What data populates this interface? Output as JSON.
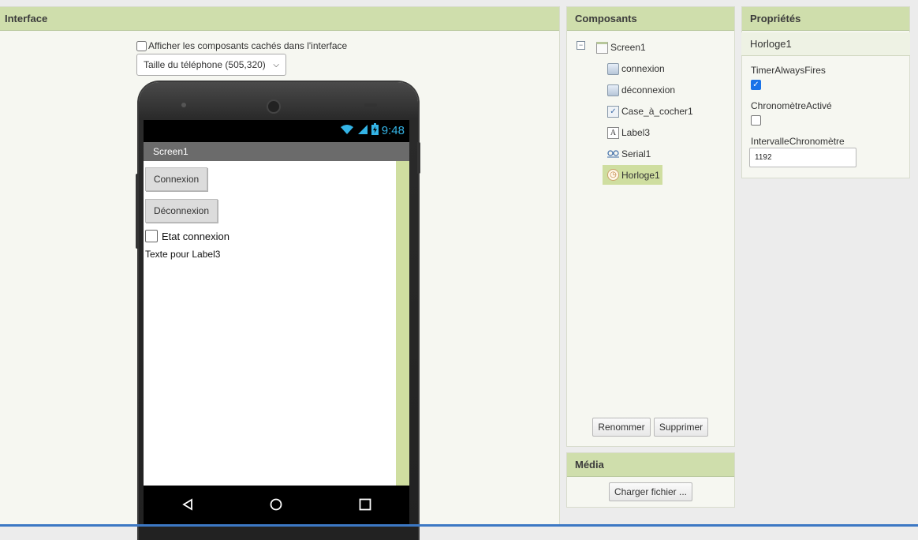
{
  "viewer": {
    "title": "Interface",
    "hidden_components_label": "Afficher les composants cachés dans l'interface",
    "hidden_components_checked": false,
    "phone_size_selected": "Taille du téléphone (505,320)",
    "phone": {
      "time": "9:48",
      "screen_title": "Screen1",
      "buttons": [
        "Connexion",
        "Déconnexion"
      ],
      "checkbox_label": "Etat connexion",
      "label_text": "Texte pour Label3"
    }
  },
  "components": {
    "title": "Composants",
    "tree": [
      {
        "name": "Screen1",
        "icon": "screen-icon"
      },
      {
        "name": "connexion",
        "icon": "button-icon"
      },
      {
        "name": "déconnexion",
        "icon": "button-icon"
      },
      {
        "name": "Case_à_cocher1",
        "icon": "checkbox-icon"
      },
      {
        "name": "Label3",
        "icon": "label-icon"
      },
      {
        "name": "Serial1",
        "icon": "serial-icon"
      },
      {
        "name": "Horloge1",
        "icon": "clock-icon",
        "selected": true
      }
    ],
    "rename_label": "Renommer",
    "delete_label": "Supprimer"
  },
  "media": {
    "title": "Média",
    "upload_label": "Charger fichier ..."
  },
  "properties": {
    "title": "Propriétés",
    "component": "Horloge1",
    "items": [
      {
        "label": "TimerAlwaysFires",
        "type": "checkbox",
        "checked": true
      },
      {
        "label": "ChronomètreActivé",
        "type": "checkbox",
        "checked": false
      },
      {
        "label": "IntervalleChronomètre",
        "type": "text",
        "value": "1192"
      }
    ]
  },
  "colors": {
    "header": "#cfdeac",
    "selected": "#cfdea0",
    "status_accent": "#34b4e6",
    "checkbox_checked": "#1a73e8"
  }
}
